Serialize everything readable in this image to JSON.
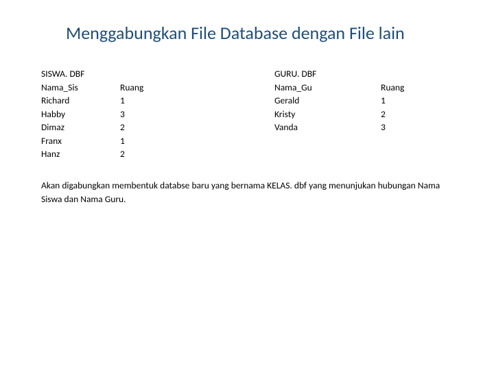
{
  "title": "Menggabungkan File Database dengan File lain",
  "left": {
    "file": "SISWA. DBF",
    "h1": "Nama_Sis",
    "h2": "Ruang",
    "rows": [
      {
        "n": "Richard",
        "r": "1"
      },
      {
        "n": "Habby",
        "r": "3"
      },
      {
        "n": "Dimaz",
        "r": "2"
      },
      {
        "n": "Franx",
        "r": "1"
      },
      {
        "n": "Hanz",
        "r": "2"
      }
    ]
  },
  "right": {
    "file": "GURU. DBF",
    "h1": "Nama_Gu",
    "h2": "Ruang",
    "rows": [
      {
        "n": "Gerald",
        "r": "1"
      },
      {
        "n": "Kristy",
        "r": "2"
      },
      {
        "n": "Vanda",
        "r": "3"
      }
    ]
  },
  "desc": "Akan digabungkan membentuk databse baru yang bernama KELAS. dbf yang menunjukan hubungan Nama Siswa dan Nama Guru."
}
